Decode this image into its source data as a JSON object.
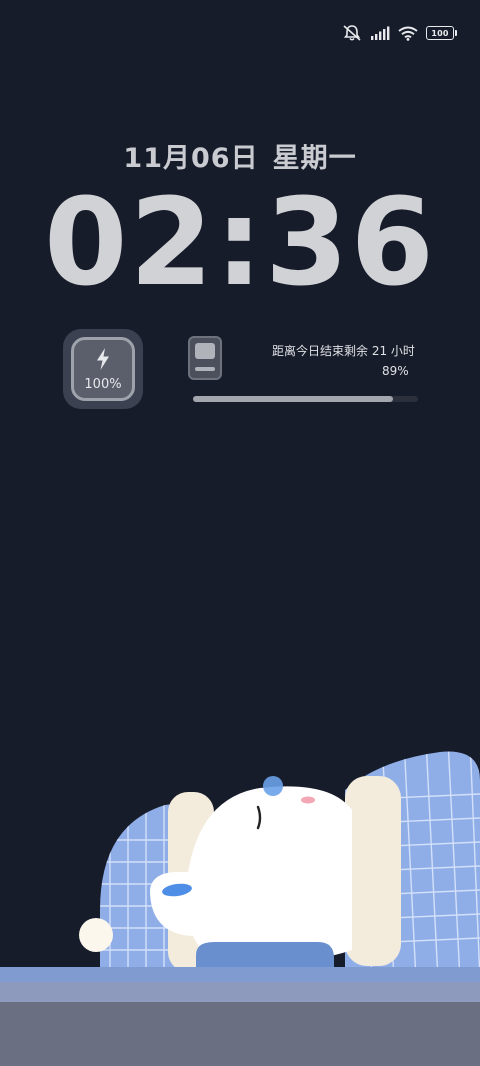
{
  "status_bar": {
    "icons": [
      "bell-muted-icon",
      "cellular-signal-icon",
      "wifi-icon",
      "battery-icon"
    ],
    "battery_text": "100"
  },
  "lock_screen": {
    "date": "11月06日",
    "weekday": "星期一",
    "time": "02:36"
  },
  "widgets": {
    "charge": {
      "icon": "lightning-bolt-icon",
      "percent_text": "100%"
    },
    "day_progress": {
      "icon": "phone-icon",
      "label": "距离今日结束剩余 21 小时",
      "percent_text": "89%",
      "fraction": 0.89
    }
  },
  "illustration": {
    "subject": "sleeping-polar-bear-illustration"
  },
  "colors": {
    "background": "#171c2a",
    "blanket": "#8faee8",
    "bear": "#ffffff",
    "progress_fill": "#a3a6ad"
  }
}
